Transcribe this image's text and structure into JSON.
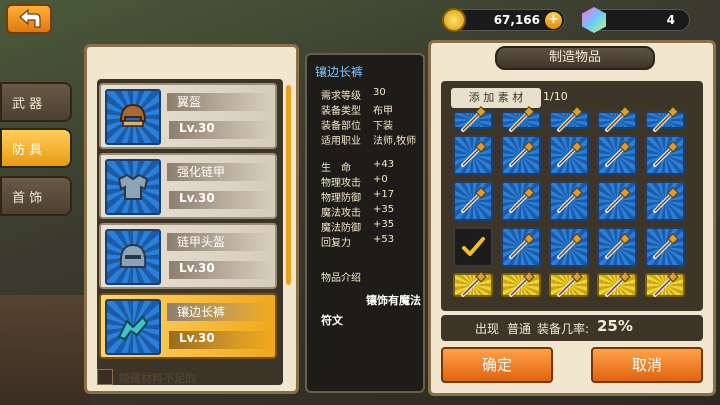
{
  "top": {
    "gold": "67,166",
    "gems": "4"
  },
  "tabs": [
    {
      "label": "武 器"
    },
    {
      "label": "防 具"
    },
    {
      "label": "首 饰"
    }
  ],
  "items": [
    {
      "name": "翼盔",
      "level": "Lv.30"
    },
    {
      "name": "强化链甲",
      "level": "Lv.30"
    },
    {
      "name": "链甲头盔",
      "level": "Lv.30"
    },
    {
      "name": "镶边长裤",
      "level": "Lv.30"
    }
  ],
  "hide_label": "隐藏材料不足的",
  "detail": {
    "title": "镶边长裤",
    "info": [
      {
        "k": "需求等级",
        "v": "30"
      },
      {
        "k": "装备类型",
        "v": "布甲"
      },
      {
        "k": "装备部位",
        "v": "下装"
      },
      {
        "k": "适用职业",
        "v": "法师,牧师"
      }
    ],
    "stats": [
      {
        "k": "生　命",
        "v": "+43"
      },
      {
        "k": "物理攻击",
        "v": "+0"
      },
      {
        "k": "物理防御",
        "v": "+17"
      },
      {
        "k": "魔法攻击",
        "v": "+35"
      },
      {
        "k": "魔法防御",
        "v": "+35"
      },
      {
        "k": "回复力",
        "v": "+53"
      }
    ],
    "desc_title": "物品介绍",
    "desc_line1": "镶饰有魔法",
    "desc_line2": "符文"
  },
  "craft": {
    "header": "制造物品",
    "add_material": "添 加 素 材",
    "material_count": "1/10",
    "chance_prefix": "出现",
    "chance_type": "普通",
    "chance_label": "装备几率:",
    "chance_value": "25%",
    "ok": "确定",
    "cancel": "取消"
  },
  "colors": {
    "accent": "#e8a31a",
    "grid_blue": "#2a7fd8",
    "grid_gold": "#f0d23a"
  }
}
